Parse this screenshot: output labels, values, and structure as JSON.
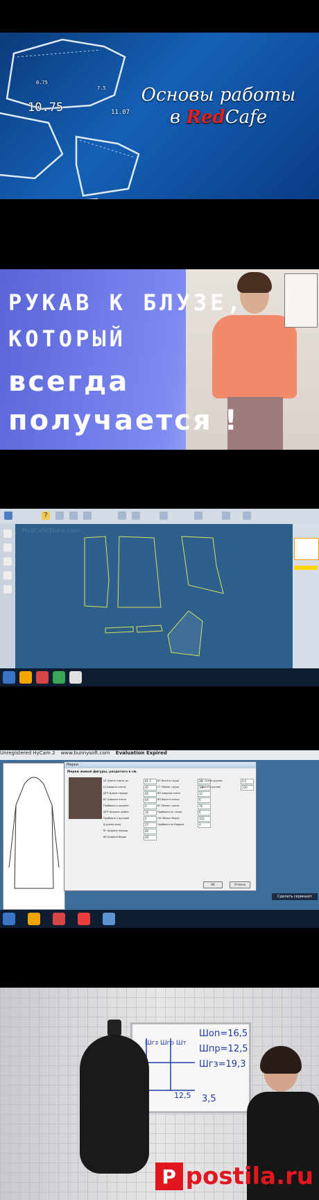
{
  "panel1": {
    "title_line1": "Основы работы",
    "title_line2_prefix": "в ",
    "title_brand_red": "Red",
    "title_brand_rest": "Cafe",
    "measure_main": "10.75",
    "measure_a": "11.07",
    "measure_b": "8.75",
    "measure_c": "7.5"
  },
  "panel2": {
    "line1": "РУКАВ К БЛУЗЕ,",
    "line2": "КОТОРЫЙ",
    "line3": "всегда",
    "line4": "получается !"
  },
  "panel3": {
    "watermark": "RedCafeStore.com"
  },
  "panel4": {
    "header_left": "Unregistered HyCam 2",
    "header_url": "www.bunnysoft.com",
    "header_eval": "Evaluation Expired",
    "dialog_title": "Мерки",
    "dialog_subtitle": "Мерки живой фигуры, раздетого в см.",
    "fields": [
      {
        "label": "ЦГ Длина спины до",
        "value": "41.5"
      },
      {
        "label": "Ш Ширина спины",
        "value": "42"
      },
      {
        "label": "ДТП Длина переда",
        "value": "45"
      },
      {
        "label": "ВС Ширина плеча",
        "value": "44"
      },
      {
        "label": "Прибавка к ширине",
        "value": "0"
      },
      {
        "label": "ДТП Ширина шейки",
        "value": "16"
      },
      {
        "label": "Прибавка к дуговой",
        "value": "0"
      },
      {
        "label": "Д длина сред",
        "value": "17"
      },
      {
        "label": "ВГ Ширина переда",
        "value": "40"
      },
      {
        "label": "ВБ Ширина бедра",
        "value": "29"
      }
    ],
    "fields2": [
      {
        "label": "ВТ Высота груди",
        "value": "22"
      },
      {
        "label": "СТ Обхват груди",
        "value": "1.6"
      },
      {
        "label": "ВП Ширина плеча",
        "value": "12"
      },
      {
        "label": "ВП Высота плеча",
        "value": "0"
      },
      {
        "label": "ВТ Обхват талии",
        "value": "76"
      },
      {
        "label": "Прибавка по талии",
        "value": "6"
      },
      {
        "label": "ОБ Обхват бедер",
        "value": "102"
      },
      {
        "label": "Прибавка по бедрам",
        "value": "4"
      }
    ],
    "fields3": [
      {
        "label": "СС Длина рукава",
        "value": "0.5"
      },
      {
        "label": "Ширина рукава",
        "value": "120"
      }
    ],
    "ok_label": "ОК",
    "cancel_label": "Отмена",
    "notification": "Сделать скриншот"
  },
  "panel5": {
    "wb_sh1": "Шоп=16,5",
    "wb_sh2": "Шпр=12,5",
    "wb_sh3": "Шгз=19,3",
    "wb_left": "Шгз Шгр Шт",
    "wb_nums": "12,5",
    "wb_nums2": "3,5",
    "logo_letter": "P",
    "logo_text": "postila.ru"
  }
}
